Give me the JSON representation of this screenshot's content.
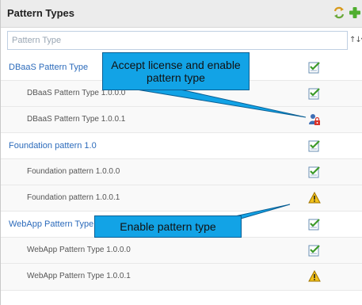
{
  "header": {
    "title": "Pattern Types"
  },
  "filter": {
    "placeholder": "Pattern Type"
  },
  "rows": [
    {
      "label": "DBaaS Pattern Type",
      "status": "enabled"
    },
    {
      "label": "DBaaS Pattern Type 1.0.0.0",
      "status": "enabled"
    },
    {
      "label": "DBaaS Pattern Type 1.0.0.1",
      "status": "license-required"
    },
    {
      "label": "Foundation pattern 1.0",
      "status": "enabled"
    },
    {
      "label": "Foundation pattern 1.0.0.0",
      "status": "enabled"
    },
    {
      "label": "Foundation pattern 1.0.0.1",
      "status": "warning"
    },
    {
      "label": "WebApp Pattern Type",
      "status": "enabled"
    },
    {
      "label": "WebApp Pattern Type 1.0.0.0",
      "status": "enabled"
    },
    {
      "label": "WebApp Pattern Type 1.0.0.1",
      "status": "warning"
    }
  ],
  "callouts": {
    "license": "Accept license and enable pattern type",
    "enable": "Enable pattern type"
  },
  "colors": {
    "callout": "#12a3e6",
    "link": "#2c6bbb",
    "header_bg": "#ececec"
  }
}
